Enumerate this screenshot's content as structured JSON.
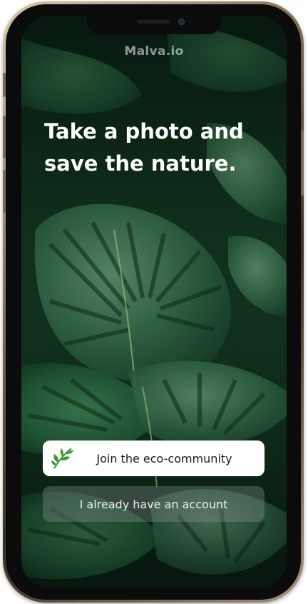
{
  "app": {
    "brand": "Malva.io"
  },
  "hero": {
    "headline": "Take a photo and save the nature."
  },
  "actions": {
    "join_label": "Join the eco-community",
    "login_label": "I already have an account"
  },
  "icons": {
    "join_icon": "leaf-icon"
  },
  "colors": {
    "primary_button_bg": "#ffffff",
    "secondary_button_bg": "rgba(140,150,150,0.35)",
    "headline_text": "#ffffff",
    "leaf_icon": "#3e9a3a"
  }
}
